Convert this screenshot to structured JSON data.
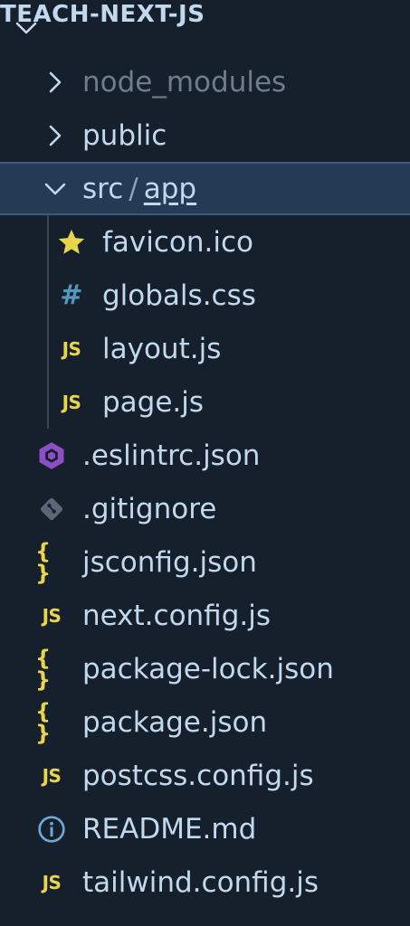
{
  "explorer": {
    "root_title": "TEACH-NEXT-JS",
    "folders": {
      "node_modules": "node_modules",
      "public": "public",
      "src": "src",
      "src_separator": "/",
      "app": "app"
    },
    "app_files": [
      {
        "label": "favicon.ico",
        "icon": "star-icon"
      },
      {
        "label": "globals.css",
        "icon": "css-hash-icon"
      },
      {
        "label": "layout.js",
        "icon": "js-icon"
      },
      {
        "label": "page.js",
        "icon": "js-icon"
      }
    ],
    "root_files": [
      {
        "label": ".eslintrc.json",
        "icon": "eslint-icon"
      },
      {
        "label": ".gitignore",
        "icon": "git-icon"
      },
      {
        "label": "jsconfig.json",
        "icon": "json-braces-icon"
      },
      {
        "label": "next.config.js",
        "icon": "js-icon"
      },
      {
        "label": "package-lock.json",
        "icon": "json-braces-icon"
      },
      {
        "label": "package.json",
        "icon": "json-braces-icon"
      },
      {
        "label": "postcss.config.js",
        "icon": "js-icon"
      },
      {
        "label": "README.md",
        "icon": "info-icon"
      },
      {
        "label": "tailwind.config.js",
        "icon": "js-icon"
      }
    ],
    "icon_text": {
      "js": "JS",
      "hash": "#",
      "braces": "{ }"
    }
  },
  "colors": {
    "background": "#16202d",
    "text": "#c2d8ec",
    "dim_text": "#6d7d8e",
    "selection": "#253a54",
    "selection_border": "#3b5b80",
    "js_yellow": "#e8d44d",
    "css_blue": "#519aba",
    "eslint_purple": "#8b4fc7",
    "git_gray": "#5a6776",
    "info_blue": "#6fa8d8"
  }
}
